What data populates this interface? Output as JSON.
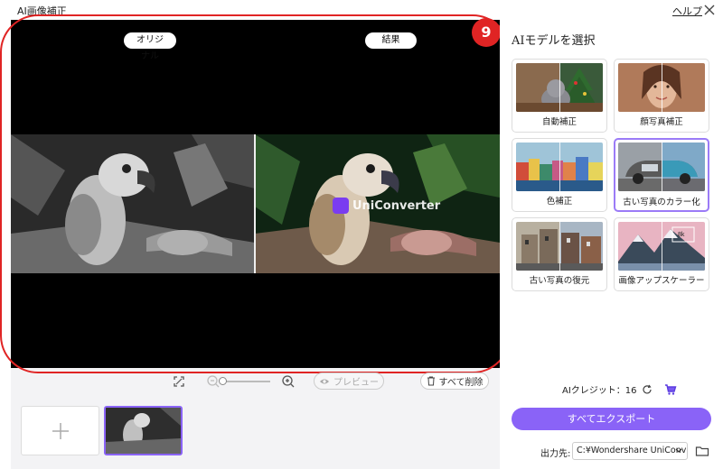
{
  "window": {
    "title": "AI画像補正",
    "help_label": "ヘルプ"
  },
  "preview": {
    "original_label": "オリジナル",
    "result_label": "結果",
    "watermark_text": "UniConverter"
  },
  "annotation": {
    "badge": "9",
    "color": "#e02424"
  },
  "toolbar": {
    "preview_label": "プレビュー",
    "delete_all_label": "すべて削除"
  },
  "models": {
    "title": "AIモデルを選択",
    "items": [
      {
        "label": "自動補正"
      },
      {
        "label": "顔写真補正"
      },
      {
        "label": "色補正"
      },
      {
        "label": "古い写真のカラー化",
        "selected": true
      },
      {
        "label": "古い写真の復元"
      },
      {
        "label": "画像アップスケーラー"
      }
    ]
  },
  "footer": {
    "credits_label": "AIクレジット：16",
    "export_label": "すべてエクスポート",
    "output_label": "出力先:",
    "output_path": "C:¥Wondershare UniConv"
  },
  "colors": {
    "accent": "#8a63f7",
    "selected_border": "#9b7bf7"
  }
}
